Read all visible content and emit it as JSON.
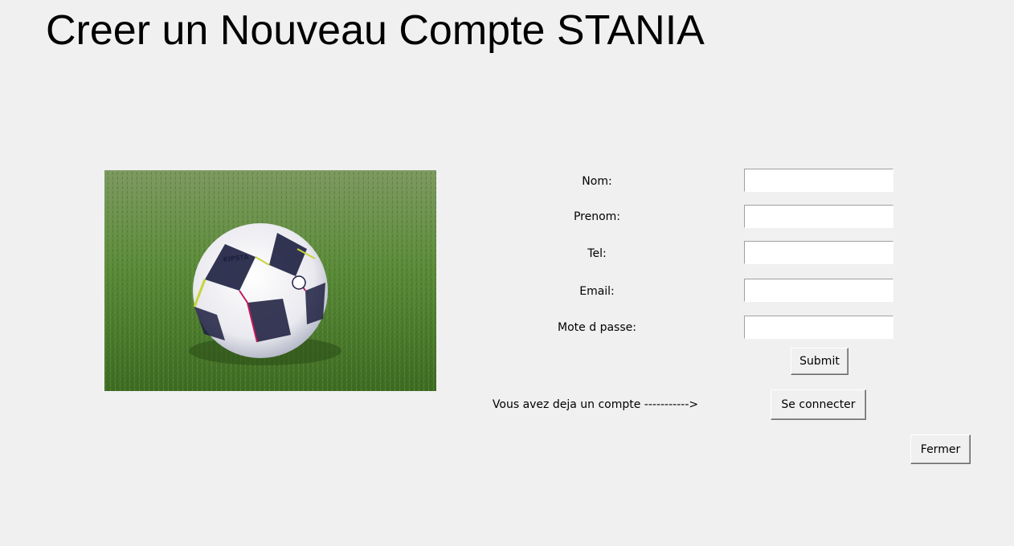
{
  "window": {
    "title": "Creer un Nouveau Compte STANIA"
  },
  "image": {
    "ball_brand": "KIPSTA",
    "description_icon": "football-on-grass-photo"
  },
  "form": {
    "fields": [
      {
        "label": "Nom:",
        "value": ""
      },
      {
        "label": "Prenom:",
        "value": ""
      },
      {
        "label": "Tel:",
        "value": ""
      },
      {
        "label": "Email:",
        "value": ""
      },
      {
        "label": "Mote d passe:",
        "value": ""
      }
    ],
    "submit_label": "Submit"
  },
  "login": {
    "prompt": "Vous avez deja un compte ----------->",
    "button_label": "Se connecter"
  },
  "close_label": "Fermer",
  "colors": {
    "background": "#f0f0f0",
    "entry_background": "#ffffff",
    "grass": "#4e7f2c"
  }
}
